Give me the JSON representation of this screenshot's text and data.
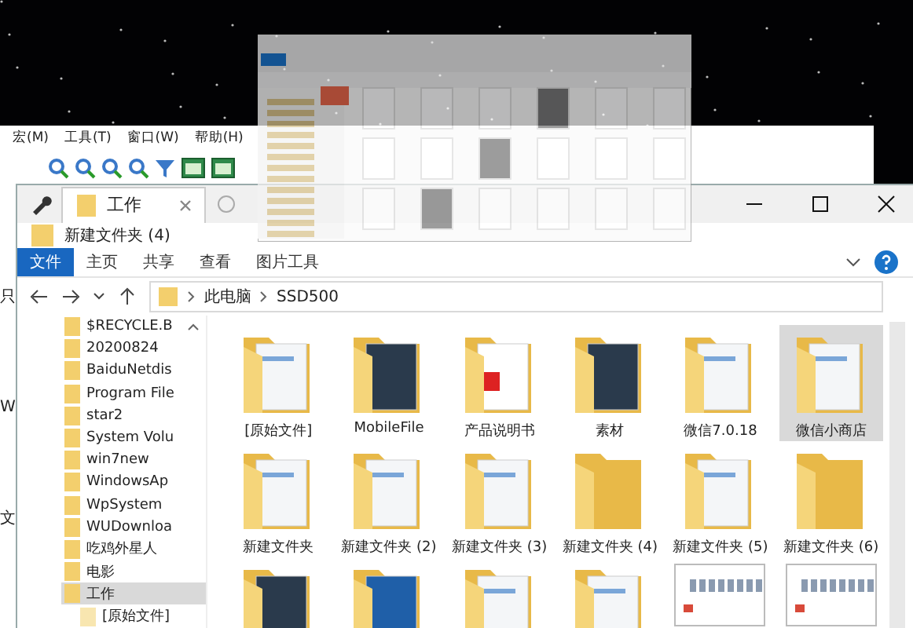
{
  "back_window": {
    "menu": [
      "宏(M)",
      "工具(T)",
      "窗口(W)",
      "帮助(H)"
    ],
    "side_fragments": [
      "只",
      "W",
      "文"
    ]
  },
  "explorer": {
    "tab": {
      "label": "工作"
    },
    "title": "新建文件夹 (4)",
    "ribbon_tabs": [
      {
        "label": "文件",
        "selected": true
      },
      {
        "label": "主页",
        "selected": false
      },
      {
        "label": "共享",
        "selected": false
      },
      {
        "label": "查看",
        "selected": false
      },
      {
        "label": "图片工具",
        "selected": false
      }
    ],
    "breadcrumb": [
      "此电脑",
      "SSD500"
    ],
    "nav_items": [
      {
        "label": "$RECYCLE.B",
        "selected": false
      },
      {
        "label": "20200824",
        "selected": false
      },
      {
        "label": "BaiduNetdis",
        "selected": false
      },
      {
        "label": "Program File",
        "selected": false
      },
      {
        "label": "star2",
        "selected": false
      },
      {
        "label": "System Volu",
        "selected": false
      },
      {
        "label": "win7new",
        "selected": false
      },
      {
        "label": "WindowsAp",
        "selected": false
      },
      {
        "label": "WpSystem",
        "selected": false
      },
      {
        "label": "WUDownloa",
        "selected": false
      },
      {
        "label": "吃鸡外星人",
        "selected": false
      },
      {
        "label": "电影",
        "selected": false
      },
      {
        "label": "工作",
        "selected": true,
        "children": [
          {
            "label": "[原始文件]",
            "selected": false
          }
        ]
      }
    ],
    "items": [
      {
        "label": "[原始文件]",
        "kind": "doc",
        "selected": false
      },
      {
        "label": "MobileFile",
        "kind": "dark",
        "selected": false
      },
      {
        "label": "产品说明书",
        "kind": "pdf",
        "selected": false
      },
      {
        "label": "素材",
        "kind": "dark",
        "selected": false
      },
      {
        "label": "微信7.0.18",
        "kind": "doc",
        "selected": false
      },
      {
        "label": "微信小商店",
        "kind": "doc",
        "selected": true
      },
      {
        "label": "新建文件夹",
        "kind": "doc",
        "selected": false
      },
      {
        "label": "新建文件夹 (2)",
        "kind": "doc",
        "selected": false
      },
      {
        "label": "新建文件夹 (3)",
        "kind": "doc",
        "selected": false
      },
      {
        "label": "新建文件夹 (4)",
        "kind": "empty",
        "selected": false
      },
      {
        "label": "新建文件夹 (5)",
        "kind": "doc",
        "selected": false
      },
      {
        "label": "新建文件夹 (6)",
        "kind": "empty",
        "selected": false
      },
      {
        "kind": "dark",
        "selected": false
      },
      {
        "kind": "blue",
        "selected": false
      },
      {
        "kind": "doc",
        "selected": false
      },
      {
        "kind": "doc",
        "selected": false
      },
      {
        "kind": "image",
        "selected": false
      },
      {
        "kind": "image",
        "selected": false
      }
    ]
  }
}
